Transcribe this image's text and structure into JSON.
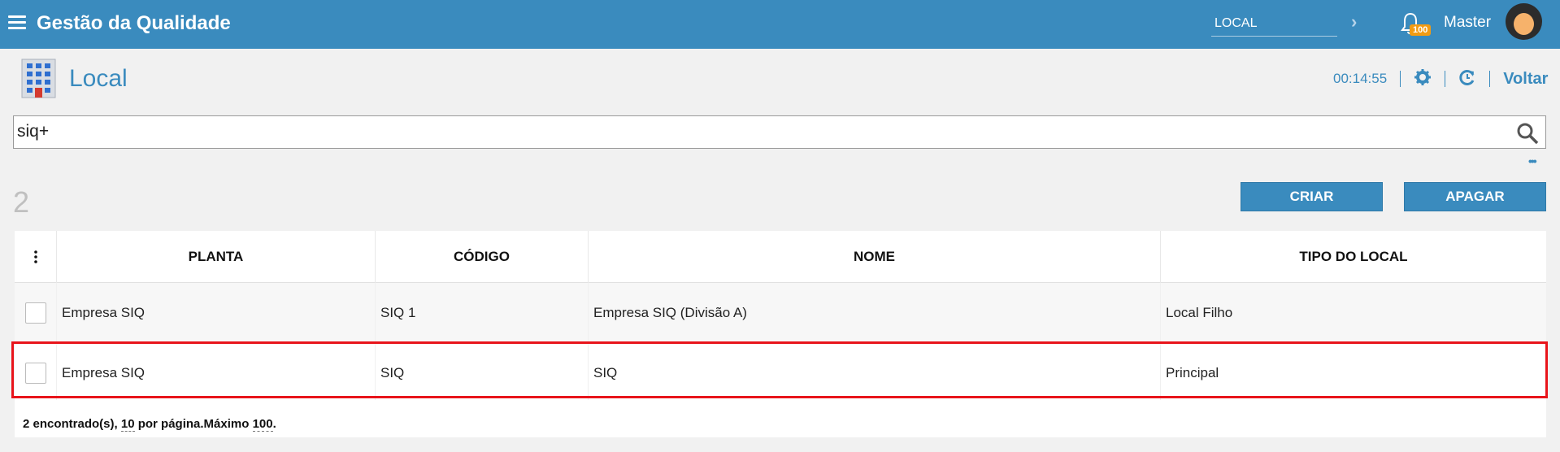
{
  "topbar": {
    "app_title": "Gestão da Qualidade",
    "local_value": "LOCAL",
    "notification_count": "100",
    "user_name": "Master"
  },
  "page": {
    "title": "Local",
    "timer": "00:14:55",
    "back_label": "Voltar"
  },
  "search": {
    "value": "siq+"
  },
  "results": {
    "count": "2",
    "create_label": "CRIAR",
    "delete_label": "APAGAR"
  },
  "table": {
    "columns": [
      "PLANTA",
      "CÓDIGO",
      "NOME",
      "TIPO DO LOCAL"
    ],
    "rows": [
      {
        "planta": "Empresa SIQ",
        "codigo": "SIQ 1",
        "nome": "Empresa SIQ (Divisão A)",
        "tipo": "Local Filho"
      },
      {
        "planta": "Empresa SIQ",
        "codigo": "SIQ",
        "nome": "SIQ",
        "tipo": "Principal"
      }
    ]
  },
  "footer": {
    "found": "2 encontrado(s), ",
    "per_page": "10",
    "per_page_suffix": " por página.Máximo ",
    "max": "100",
    "end": "."
  },
  "colors": {
    "brand": "#3a8bbe",
    "highlight": "#e8141b",
    "badge": "#f39c12"
  },
  "icons": [
    "menu-icon",
    "chevron-right-icon",
    "bell-icon",
    "avatar",
    "building-icon",
    "gear-icon",
    "refresh-icon",
    "search-icon",
    "more-options-icon",
    "column-menu-icon"
  ]
}
